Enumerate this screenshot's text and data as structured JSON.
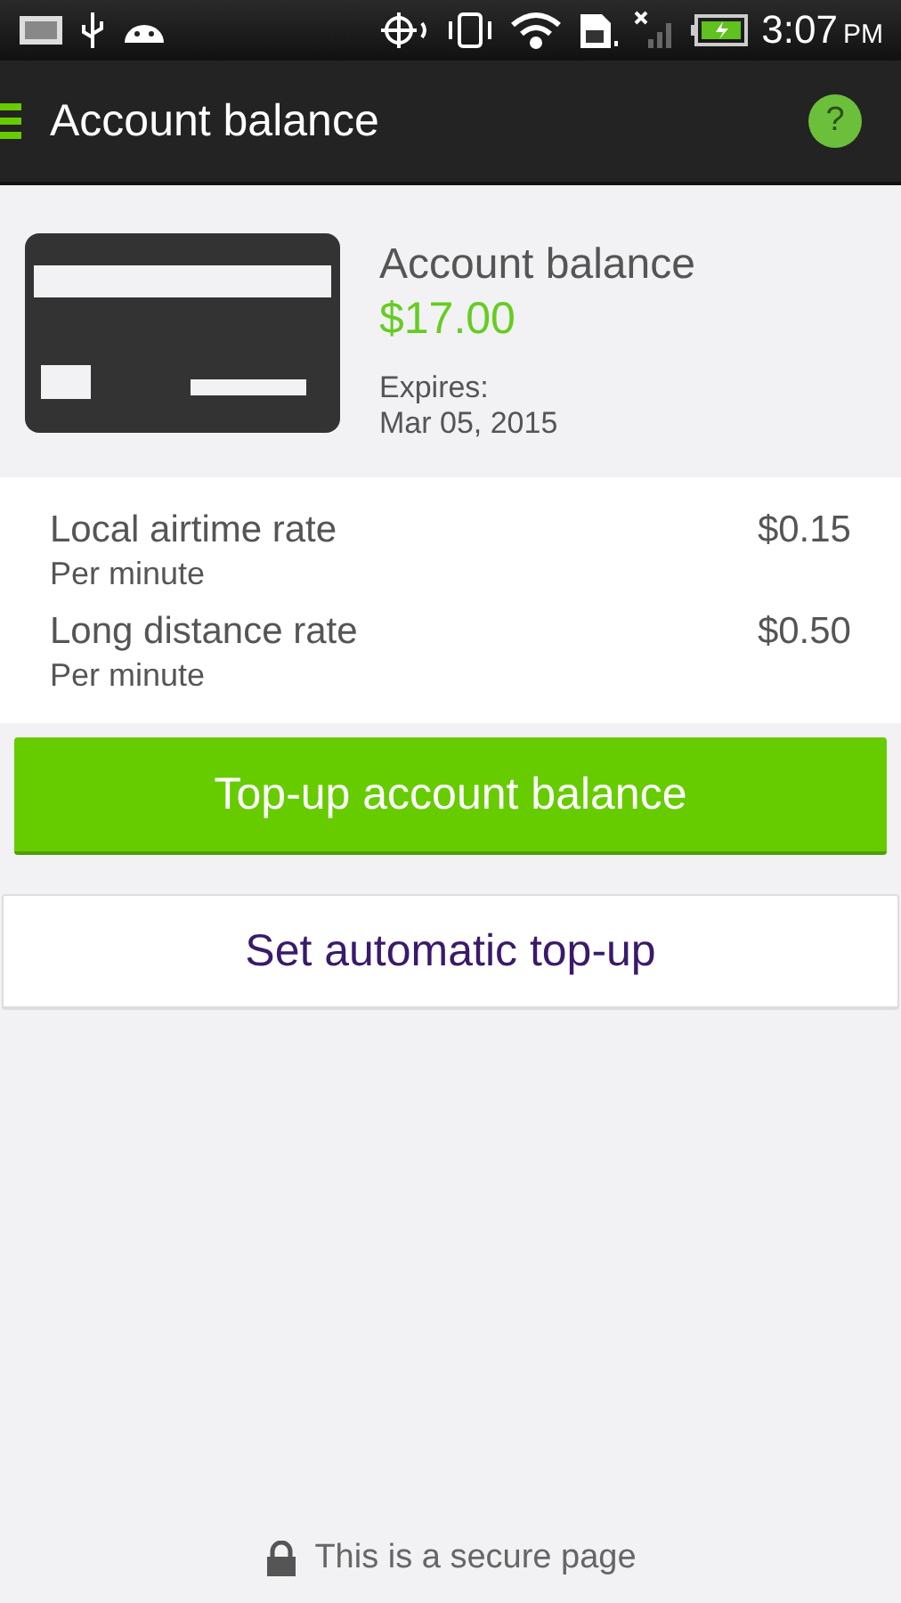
{
  "status_bar": {
    "time": "3:07",
    "meridiem": "PM"
  },
  "app_bar": {
    "title": "Account balance",
    "help": "?"
  },
  "balance": {
    "label": "Account balance",
    "amount": "$17.00",
    "expires_label": "Expires:",
    "expires_date": "Mar 05, 2015"
  },
  "rates": [
    {
      "name": "Local airtime rate",
      "unit": "Per minute",
      "price": "$0.15"
    },
    {
      "name": "Long distance rate",
      "unit": "Per minute",
      "price": "$0.50"
    }
  ],
  "buttons": [
    {
      "kind": "primary",
      "label": "Top-up account balance"
    },
    {
      "kind": "secondary",
      "label": "Set automatic top-up"
    }
  ],
  "footer": {
    "text": "This is a secure page"
  }
}
